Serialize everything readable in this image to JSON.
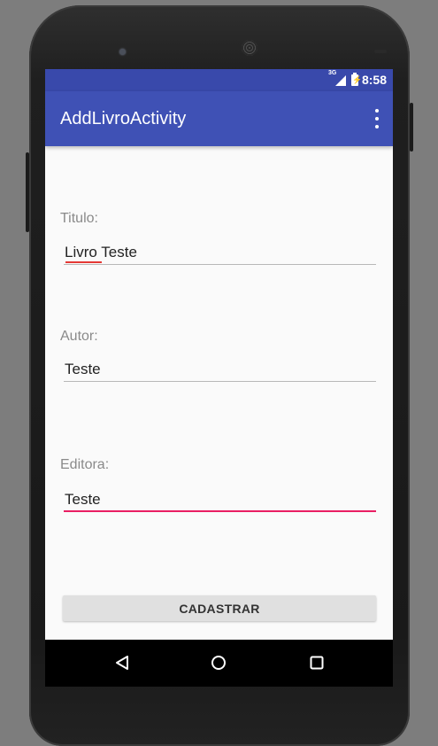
{
  "status_bar": {
    "network": "3G",
    "time": "8:58"
  },
  "app_bar": {
    "title": "AddLivroActivity",
    "overflow_icon": "more-vert-icon"
  },
  "form": {
    "titulo": {
      "label": "Titulo:",
      "value": "Livro Teste"
    },
    "autor": {
      "label": "Autor:",
      "value": "Teste"
    },
    "editora": {
      "label": "Editora:",
      "value": "Teste"
    },
    "submit_label": "CADASTRAR"
  },
  "nav": {
    "back_icon": "back-triangle-icon",
    "home_icon": "home-circle-icon",
    "recents_icon": "recents-square-icon"
  },
  "colors": {
    "status_bar": "#3949ab",
    "app_bar": "#3f51b5",
    "accent": "#e91e63",
    "background": "#fafafa",
    "spell_error": "#e53935"
  }
}
